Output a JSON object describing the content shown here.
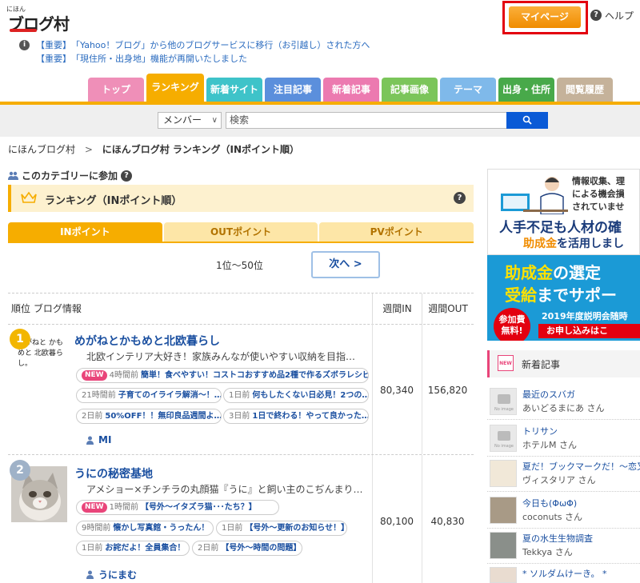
{
  "header": {
    "logo_small": "にほん",
    "logo_main": "ブログ村",
    "mypage_label": "マイページ",
    "help_label": "ヘルプ"
  },
  "notices": [
    {
      "tag": "【重要】",
      "text": "「Yahoo！ブログ」から他のブログサービスに移行（お引越し）された方へ"
    },
    {
      "tag": "【重要】",
      "text": "「現住所・出身地」機能が再開いたしました"
    }
  ],
  "nav_tabs": [
    {
      "label": "トップ",
      "color": "#ef8fb8"
    },
    {
      "label": "ランキング",
      "color": "#f6ad00",
      "active": true
    },
    {
      "label": "新着サイト",
      "color": "#3ec3c9"
    },
    {
      "label": "注目記事",
      "color": "#5b8fdc"
    },
    {
      "label": "新着記事",
      "color": "#ec7ab0"
    },
    {
      "label": "記事画像",
      "color": "#7bc55a"
    },
    {
      "label": "テーマ",
      "color": "#7fb9ea"
    },
    {
      "label": "出身・住所",
      "color": "#48a94a"
    },
    {
      "label": "閲覧履歴",
      "color": "#c5b29a"
    }
  ],
  "search": {
    "select_value": "メンバー",
    "placeholder": "検索"
  },
  "breadcrumb": {
    "home": "にほんブログ村",
    "separator": ">",
    "current": "にほんブログ村 ランキング（INポイント順）"
  },
  "join_label": "このカテゴリーに参加",
  "ranking_title": "ランキング（INポイント順）",
  "sub_tabs": [
    {
      "label": "INポイント",
      "active": true
    },
    {
      "label": "OUTポイント"
    },
    {
      "label": "PVポイント"
    }
  ],
  "range_text": "1位〜50位",
  "next_label": "次へ >",
  "table": {
    "headers": [
      "順位 ブログ情報",
      "週間IN",
      "週間OUT"
    ],
    "rows": [
      {
        "rank": "1",
        "thumb_text": "めがねと かもめと 北欧暮らし。",
        "title": "めがねとかもめと北欧暮らし",
        "desc": "北欧インテリア大好き！家族みんなが使いやすい収納を目指…",
        "posts": [
          {
            "new": "NEW",
            "time": "4時間前",
            "title": "簡単！食べやすい！コストコおすすめ品2種で作るズボラレシピ"
          },
          {
            "time": "21時間前",
            "title": "子育てのイライラ解消〜！…"
          },
          {
            "time": "1日前",
            "title": "何もしたくない日必見！2つの…"
          },
          {
            "time": "2日前",
            "title": "50%OFF！！無印良品週間よ…"
          },
          {
            "time": "3日前",
            "title": "1日で終わる！やって良かった…"
          }
        ],
        "author": "MI",
        "in": "80,340",
        "out": "156,820"
      },
      {
        "rank": "2",
        "title": "うにの秘密基地",
        "desc": "アメショー×チンチラの丸顔猫『うに』と飼い主のこぢんまり…",
        "posts": [
          {
            "new": "NEW",
            "time": "1時間前",
            "title": "【号外〜イタズラ猫･･･たち？】"
          },
          {
            "time": "9時間前",
            "title": "懐かし写真館・うったん！"
          },
          {
            "time": "1日前",
            "title": "【号外〜更新のお知らせ！】"
          },
          {
            "time": "1日前",
            "title": "お詫だよ！全員集合！"
          },
          {
            "time": "2日前",
            "title": "【号外〜時間の問題】"
          }
        ],
        "author": "うにまむ",
        "in": "80,100",
        "out": "40,830"
      }
    ]
  },
  "ad": {
    "lines": [
      "情報収集、理",
      "による機会損",
      "されていませ"
    ],
    "big1": "人手不足も人材の確",
    "big2a": "助成金",
    "big2b": "を活用しまし",
    "blue1a": "助成金",
    "blue1b": "の選定",
    "blue2a": "受給",
    "blue2b": "までサポー",
    "circle": "参加費 無料!",
    "event": "2019年度説明会随時",
    "cta": "お申し込みはこ"
  },
  "side": {
    "header": "新着記事",
    "new_icon": "NEW",
    "no_image": "No image",
    "items": [
      {
        "title": "最近のスバガ",
        "author": "あいどるまにあ さん"
      },
      {
        "title": "トリサン",
        "author": "ホテルM さん"
      },
      {
        "title": "夏だ！ブックマークだ！〜恋又…",
        "author": "ヴィスタリア さん"
      },
      {
        "title": "今日も(ΦωΦ)",
        "author": "coconuts さん"
      },
      {
        "title": "夏の水生生物調査",
        "author": "Tekkya さん"
      },
      {
        "title": "* ソルダムけーき。 *",
        "author": ""
      }
    ]
  },
  "colors": {
    "accent": "#f6ad00",
    "link": "#1a4fa0",
    "highlight_border": "#e3000f",
    "new_badge": "#e9457a"
  }
}
